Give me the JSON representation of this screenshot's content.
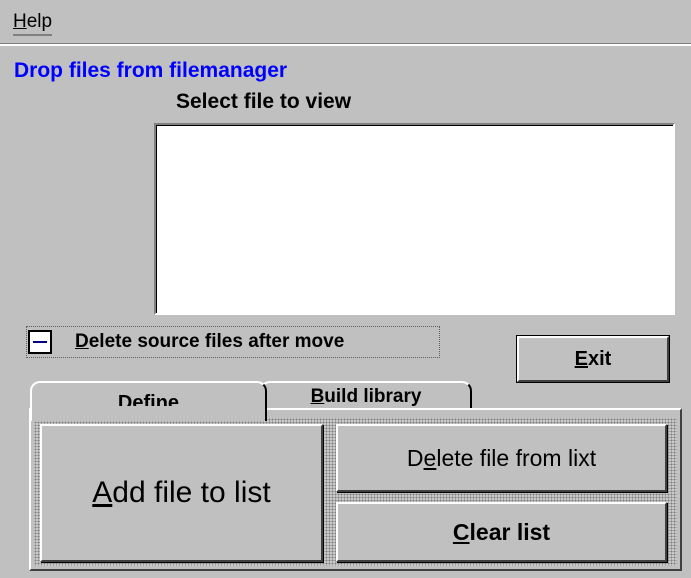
{
  "menu": {
    "help_u": "H",
    "help_rest": "elp"
  },
  "drop_label": "Drop files from filemanager",
  "select_label": "Select file to view",
  "file_list": [],
  "delete_checkbox": {
    "label_u": "D",
    "label_rest": "elete source files after move",
    "state": "indeterminate",
    "icon": "dash-icon"
  },
  "exit_button": {
    "label_u": "E",
    "label_rest": "xit"
  },
  "tabs": [
    {
      "label_u": "D",
      "label_rest": "efine",
      "active": true
    },
    {
      "label_u": "B",
      "label_rest": "uild library",
      "active": false
    }
  ],
  "buttons": {
    "add_u": "A",
    "add_rest": "dd file to list",
    "delete_pre": "D",
    "delete_u": "e",
    "delete_rest": "lete file from lixt",
    "clear_u": "C",
    "clear_rest": "lear list"
  },
  "colors": {
    "face": "#c0c0c0",
    "highlight": "#ffffff",
    "shadow": "#808080",
    "drop_label": "#0000ff"
  }
}
